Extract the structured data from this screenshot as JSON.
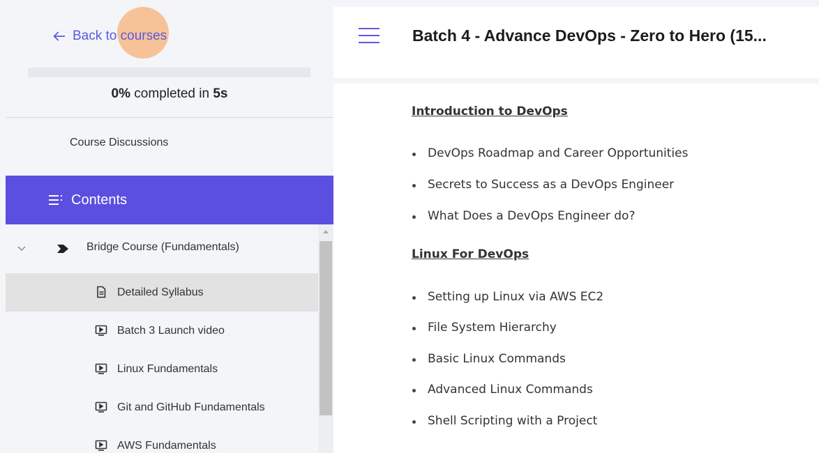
{
  "sidebar": {
    "back_label": "Back to courses",
    "progress": {
      "percent_value": 0,
      "percent_text": "0%",
      "middle_text": " completed in ",
      "duration": "5s"
    },
    "discussions_label": "Course Discussions",
    "contents_label": "Contents",
    "section": {
      "label": "Bridge Course (Fundamentals)"
    },
    "lessons": [
      {
        "label": "Detailed Syllabus",
        "icon": "document-icon",
        "active": true
      },
      {
        "label": "Batch 3 Launch video",
        "icon": "video-icon"
      },
      {
        "label": "Linux Fundamentals",
        "icon": "video-icon"
      },
      {
        "label": "Git and GitHub Fundamentals",
        "icon": "video-icon"
      },
      {
        "label": "AWS Fundamentals",
        "icon": "video-icon"
      }
    ]
  },
  "header": {
    "course_title": "Batch 4 - Advance DevOps - Zero to Hero (15..."
  },
  "main": {
    "sections": [
      {
        "heading": "Introduction to DevOps",
        "items": [
          "DevOps Roadmap and Career Opportunities",
          "Secrets to Success as a DevOps Engineer",
          "What Does a DevOps Engineer do?"
        ]
      },
      {
        "heading": "Linux For DevOps",
        "items": [
          "Setting up Linux via AWS EC2",
          "File System Hierarchy",
          "Basic Linux Commands",
          "Advanced Linux Commands",
          "Shell Scripting with a Project"
        ]
      }
    ]
  },
  "colors": {
    "accent": "#5b4fe0",
    "link": "#5b59e0"
  }
}
